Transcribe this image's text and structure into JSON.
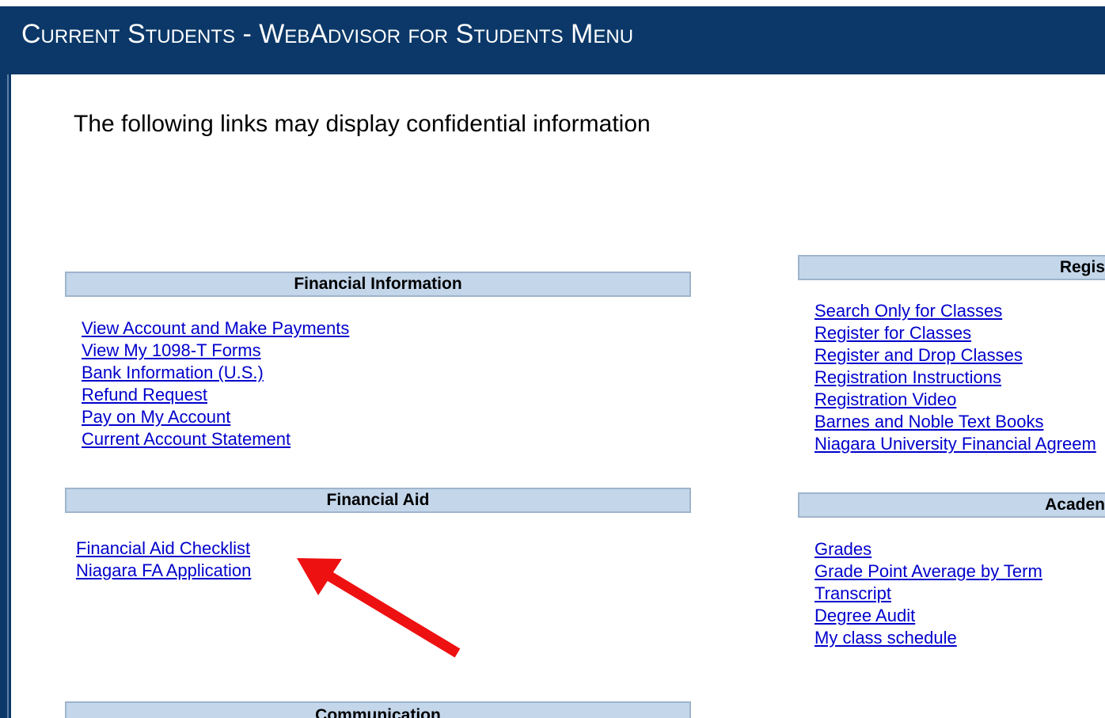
{
  "header": {
    "title": "Current Students - WebAdvisor for Students Menu"
  },
  "notice": "The following links may display confidential information",
  "sections": {
    "financial_information": {
      "title": "Financial Information",
      "links": [
        "View Account and Make Payments",
        "View My 1098-T Forms",
        "Bank Information (U.S.)",
        "Refund Request",
        "Pay on My Account",
        "Current Account Statement"
      ]
    },
    "financial_aid": {
      "title": "Financial Aid",
      "links": [
        "Financial Aid Checklist",
        "Niagara FA Application"
      ]
    },
    "communication": {
      "title": "Communication"
    },
    "registration": {
      "title": "Regis",
      "links": [
        "Search Only for Classes",
        "Register for Classes",
        "Register and Drop Classes",
        "Registration Instructions",
        "Registration Video",
        "Barnes and Noble Text Books",
        "Niagara University Financial Agreem"
      ]
    },
    "academic": {
      "title": "Acaden",
      "links": [
        "Grades",
        "Grade Point Average by Term",
        "Transcript",
        "Degree Audit",
        "My class schedule"
      ]
    }
  },
  "colors": {
    "header_bg": "#0b3868",
    "section_header_bg": "#c3d6ea",
    "link": "#0000cc",
    "annotation_arrow": "#ee1111"
  },
  "icons": {
    "annotation": "red-arrow-icon"
  }
}
